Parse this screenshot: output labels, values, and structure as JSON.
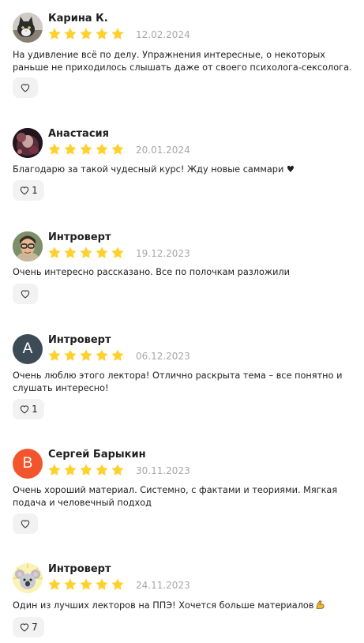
{
  "colors": {
    "star": "#ffd12e",
    "date": "#a8a8a8",
    "like_bg": "#f2f2f2",
    "avatar_letter_a": "#3d4b57",
    "avatar_letter_b": "#f2552c"
  },
  "reviews": [
    {
      "author": "Карина К.",
      "rating": 5,
      "date": "12.02.2024",
      "text": "На удивление всё по делу. Упражнения интересные, о некоторых раньше не приходилось слышать даже от своего психолога-сексолога.",
      "likes": "",
      "avatar": "cat-photo"
    },
    {
      "author": "Анастасия",
      "rating": 5,
      "date": "20.01.2024",
      "text": "Благодарю за такой чудесный курс! Жду новые саммари ♥",
      "likes": "1",
      "avatar": "dark-portrait-photo"
    },
    {
      "author": "Интроверт",
      "rating": 5,
      "date": "19.12.2023",
      "text": "Очень интересно рассказано. Все по полочкам разложили",
      "likes": "",
      "avatar": "person-glasses-photo"
    },
    {
      "author": "Интроверт",
      "rating": 5,
      "date": "06.12.2023",
      "text": "Очень люблю этого лектора! Отлично раскрыта тема – все понятно и слушать интересно!",
      "likes": "1",
      "avatar": "letter",
      "avatar_letter": "А"
    },
    {
      "author": "Сергей Барыкин",
      "rating": 5,
      "date": "30.11.2023",
      "text": "Очень хороший материал. Системно, с фактами и теориями. Мягкая подача и человечный подход",
      "likes": "",
      "avatar": "letter",
      "avatar_letter": "В"
    },
    {
      "author": "Интроверт",
      "rating": 5,
      "date": "24.11.2023",
      "text": "Один из лучших лекторов на ППЭ! Хочется больше материалов",
      "text_emoji": "flexed-biceps-icon",
      "likes": "7",
      "avatar": "koala-illustration"
    }
  ]
}
